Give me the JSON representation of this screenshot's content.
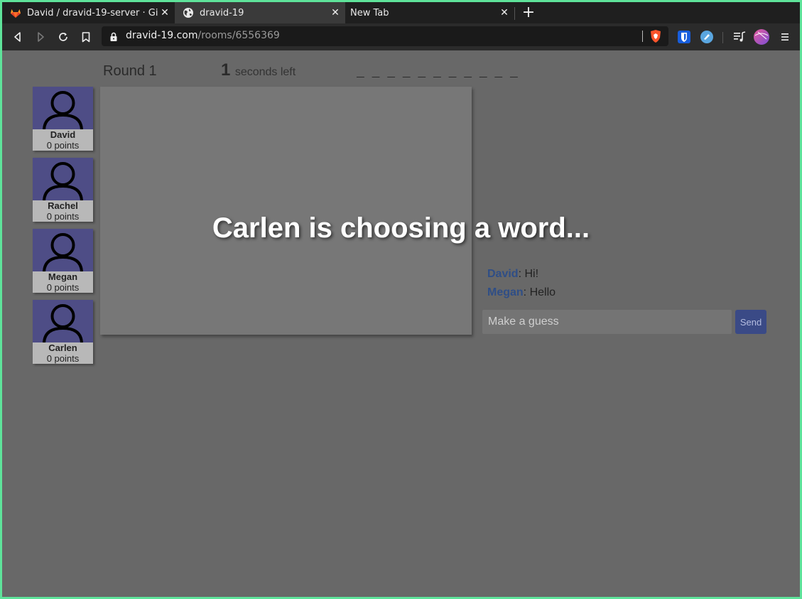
{
  "tabs": [
    {
      "title": "David / dravid-19-server · GitLab",
      "icon": "gitlab-icon",
      "active": false
    },
    {
      "title": "dravid-19",
      "icon": "globe-icon",
      "active": true
    },
    {
      "title": "New Tab",
      "icon": "",
      "active": false
    }
  ],
  "urlbar": {
    "domain": "dravid-19.com",
    "path": "/rooms/6556369"
  },
  "game": {
    "round_label": "Round 1",
    "timer_value": "1",
    "timer_suffix": "seconds left",
    "word_blanks": "_ _ _ _ _ _ _ _ _ _ _",
    "overlay_message": "Carlen is choosing a word..."
  },
  "players": [
    {
      "name": "David",
      "points": "0 points"
    },
    {
      "name": "Rachel",
      "points": "0 points"
    },
    {
      "name": "Megan",
      "points": "0 points"
    },
    {
      "name": "Carlen",
      "points": "0 points"
    }
  ],
  "chat": [
    {
      "author": "David",
      "text": ": Hi!"
    },
    {
      "author": "Megan",
      "text": ": Hello"
    }
  ],
  "guess": {
    "placeholder": "Make a guess",
    "send_label": "Send"
  },
  "colors": {
    "accent_green": "#5ee39a",
    "avatar_bg": "#4e4d86",
    "send_bg": "#3a4a86",
    "chat_author": "#2f4e86"
  }
}
